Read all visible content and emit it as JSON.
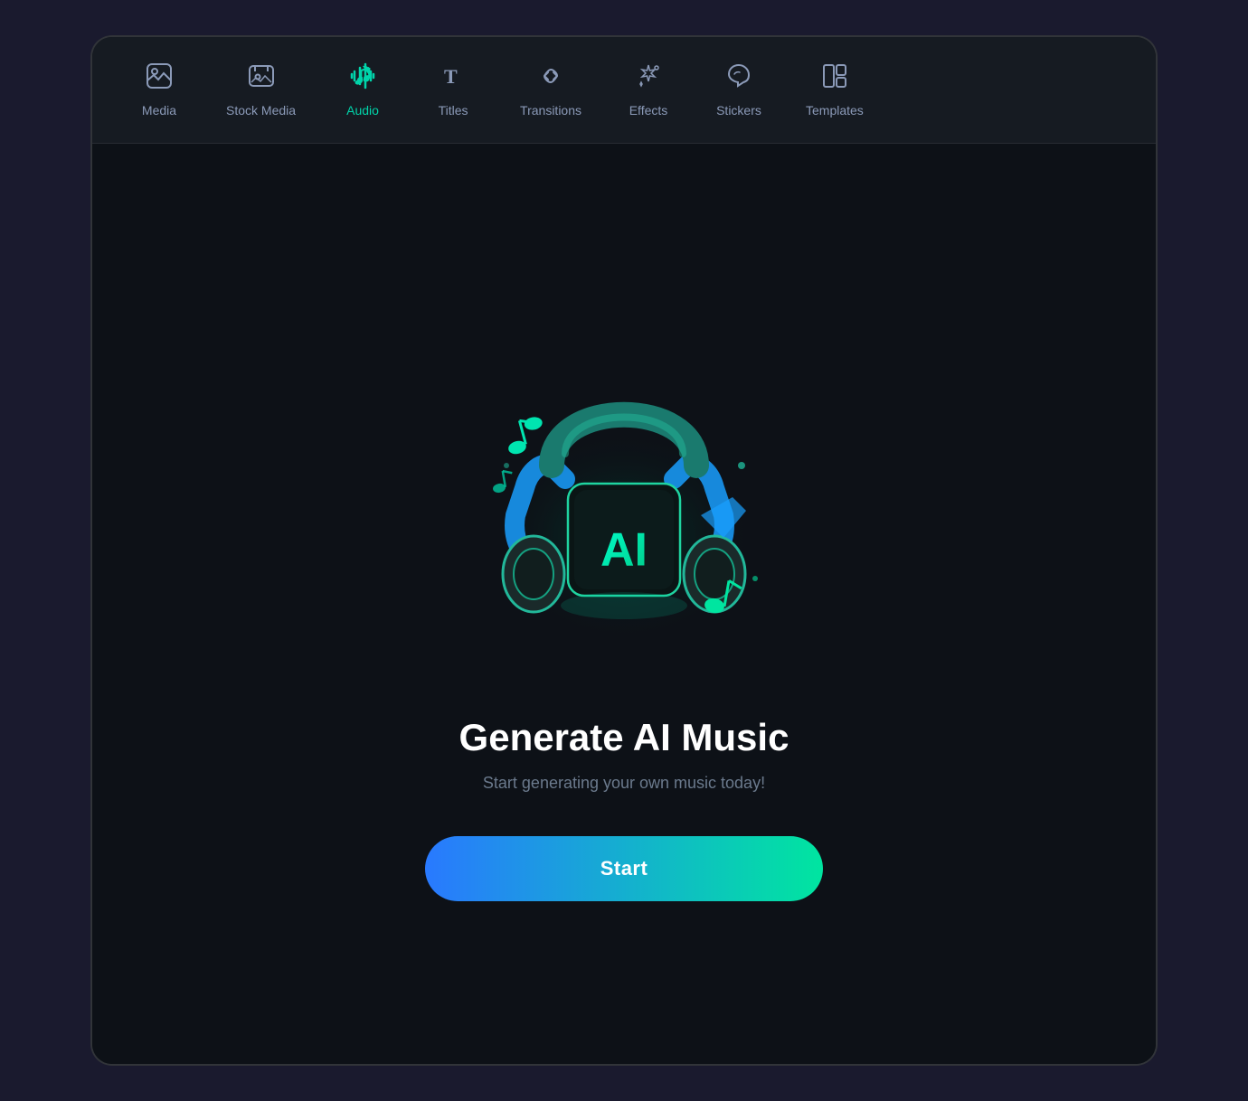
{
  "app": {
    "background": "#0d1117",
    "border_color": "rgba(255,255,255,0.15)"
  },
  "toolbar": {
    "items": [
      {
        "id": "media",
        "label": "Media",
        "icon": "media",
        "active": false
      },
      {
        "id": "stock-media",
        "label": "Stock Media",
        "icon": "stock-media",
        "active": false
      },
      {
        "id": "audio",
        "label": "Audio",
        "icon": "audio",
        "active": true
      },
      {
        "id": "titles",
        "label": "Titles",
        "icon": "titles",
        "active": false
      },
      {
        "id": "transitions",
        "label": "Transitions",
        "icon": "transitions",
        "active": false
      },
      {
        "id": "effects",
        "label": "Effects",
        "icon": "effects",
        "active": false
      },
      {
        "id": "stickers",
        "label": "Stickers",
        "icon": "stickers",
        "active": false
      },
      {
        "id": "templates",
        "label": "Templates",
        "icon": "templates",
        "active": false
      }
    ]
  },
  "main": {
    "title": "Generate AI Music",
    "subtitle": "Start generating your own music today!",
    "start_button_label": "Start"
  },
  "colors": {
    "active": "#00d4aa",
    "inactive_icon": "#8b9ab8",
    "inactive_label": "#8b9ab8",
    "subtitle": "#6b7a8d",
    "button_gradient_start": "#2979ff",
    "button_gradient_end": "#00e5a0"
  }
}
